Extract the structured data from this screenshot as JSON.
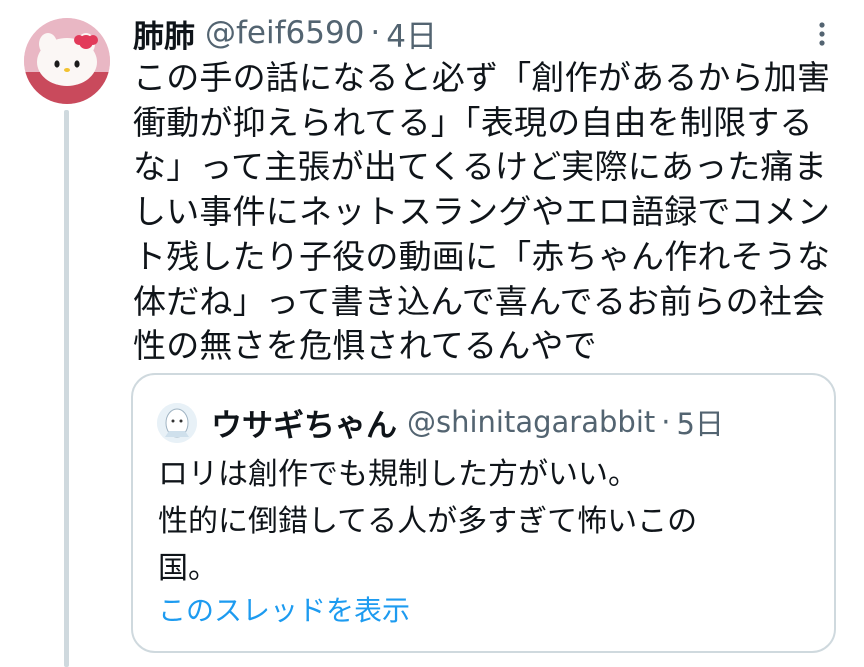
{
  "tweet": {
    "display_name": "肺肺",
    "handle": "@feif6590",
    "separator": "·",
    "time": "4日",
    "text": "この手の話になると必ず「創作があるから加害\n衝動が抑えられてる」「表現の自由を制限する\nな」って主張が出てくるけど実際にあった痛ま\nしい事件にネットスラングやエロ語録でコメン\nト残したり子役の動画に「赤ちゃん作れそうな\n体だね」って書き込んで喜んでるお前らの社会\n性の無さを危惧されてるんやで"
  },
  "quote": {
    "display_name": "ウサギちゃん",
    "handle": "@shinitagarabbit",
    "separator": "·",
    "time": "5日",
    "text": "ロリは創作でも規制した方がいい。\n性的に倒錯してる人が多すぎて怖いこの\n国。",
    "show_thread_label": "このスレッドを表示"
  },
  "colors": {
    "text_primary": "#0f1419",
    "text_secondary": "#536471",
    "link": "#1d9bf0",
    "border": "#cfd9de"
  },
  "icons": {
    "avatar": "hello-kitty-avatar",
    "quote_avatar": "rabbit-avatar",
    "more": "more-vertical-icon"
  }
}
